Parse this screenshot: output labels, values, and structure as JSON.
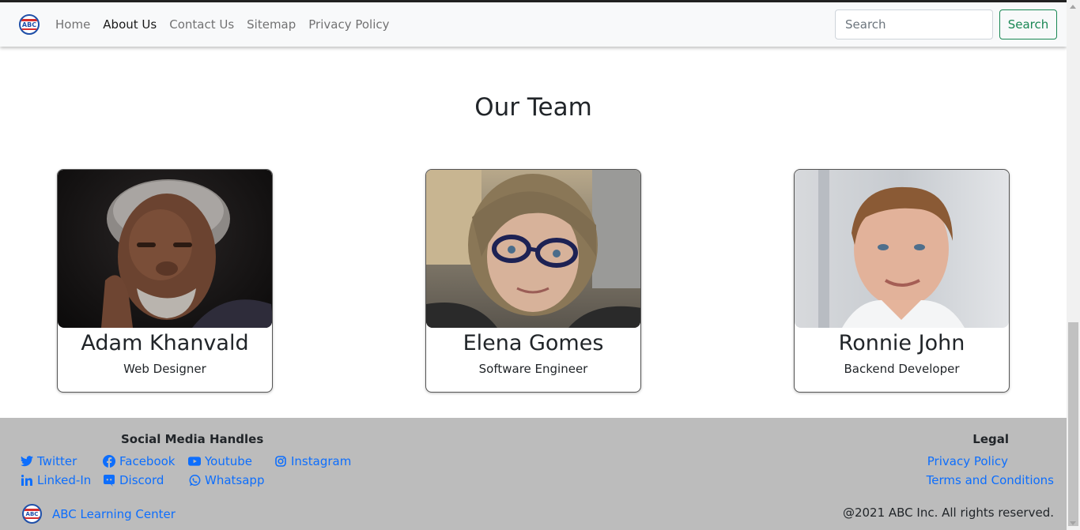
{
  "navbar": {
    "logo_text": "ABC",
    "links": [
      {
        "label": "Home",
        "active": false
      },
      {
        "label": "About Us",
        "active": true
      },
      {
        "label": "Contact Us",
        "active": false
      },
      {
        "label": "Sitemap",
        "active": false
      },
      {
        "label": "Privacy Policy",
        "active": false
      }
    ],
    "search_placeholder": "Search",
    "search_button": "Search"
  },
  "team": {
    "title": "Our Team",
    "members": [
      {
        "name": "Adam Khanvald",
        "role": "Web Designer"
      },
      {
        "name": "Elena Gomes",
        "role": "Software Engineer"
      },
      {
        "name": "Ronnie John",
        "role": "Backend Developer"
      }
    ]
  },
  "footer": {
    "social_heading": "Social Media Handles",
    "social_links": [
      {
        "label": "Twitter",
        "icon": "twitter-icon"
      },
      {
        "label": "Facebook",
        "icon": "facebook-icon"
      },
      {
        "label": "Youtube",
        "icon": "youtube-icon"
      },
      {
        "label": "Instagram",
        "icon": "instagram-icon"
      },
      {
        "label": "Linked-In",
        "icon": "linkedin-icon"
      },
      {
        "label": "Discord",
        "icon": "discord-icon"
      },
      {
        "label": "Whatsapp",
        "icon": "whatsapp-icon"
      }
    ],
    "legal_heading": "Legal",
    "legal_links": [
      "Privacy Policy",
      "Terms and Conditions"
    ],
    "brand_name": "ABC Learning Center",
    "copyright": "@2021 ABC Inc. All rights reserved."
  },
  "colors": {
    "link": "#0d6efd",
    "search_button": "#198754",
    "footer_bg": "#bcbcbc"
  }
}
